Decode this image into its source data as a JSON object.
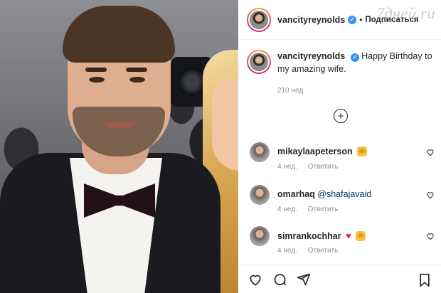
{
  "header": {
    "username": "vancityreynolds",
    "separator": "•",
    "follow_label": "Подписаться",
    "watermark": "7дней.ru"
  },
  "caption": {
    "username": "vancityreynolds",
    "text": "Happy Birthday to my amazing wife.",
    "time": "210 нед."
  },
  "load_more_icon": "plus-circle-icon",
  "comments": [
    {
      "username": "mikaylaapeterson",
      "text": "",
      "emoji": "raising-hands",
      "time": "4 нед.",
      "reply": "Ответить"
    },
    {
      "username": "omarhaq",
      "text": "@shafajavaid",
      "emoji": "",
      "time": "4 нед.",
      "reply": "Ответить"
    },
    {
      "username": "simrankochhar",
      "text": "",
      "emoji": "heart-and-raising-hands",
      "time": "4 нед.",
      "reply": "Ответить"
    }
  ],
  "actions": [
    "heart-icon",
    "comment-icon",
    "share-icon",
    "bookmark-icon"
  ],
  "colors": {
    "verified": "#3897f0",
    "mention": "#00376b",
    "secondary_text": "#8e8e8e"
  }
}
